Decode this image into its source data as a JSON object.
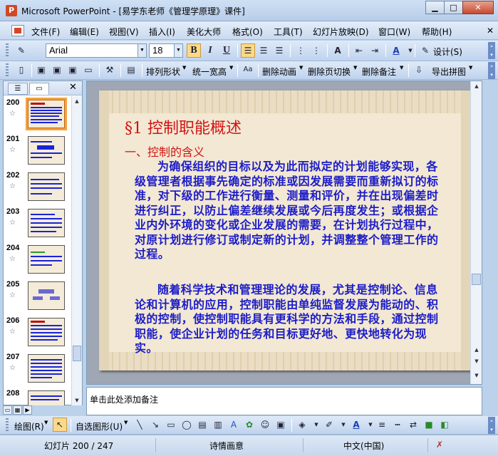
{
  "window": {
    "title": "Microsoft PowerPoint - [易学东老师《管理学原理》课件]",
    "buttons": {
      "minimize": "▁",
      "maximize": "□",
      "close": "✕"
    }
  },
  "menu": {
    "items": [
      "文件(F)",
      "编辑(E)",
      "视图(V)",
      "插入(I)",
      "美化大师",
      "格式(O)",
      "工具(T)",
      "幻灯片放映(D)",
      "窗口(W)",
      "帮助(H)"
    ]
  },
  "format_toolbar": {
    "font": "Arial",
    "size": "18",
    "bold": "B",
    "italic": "I",
    "underline": "U",
    "design_label": "设计(S)"
  },
  "toolbar2": {
    "arrange": "排列形状",
    "same_width": "统一宽高",
    "remove_anim": "删除动画",
    "remove_transition": "删除页切换",
    "remove_notes": "删除备注",
    "export": "导出拼图"
  },
  "slides_panel": {
    "close": "✕",
    "selected": "200",
    "slides": [
      {
        "num": "200",
        "type": "text"
      },
      {
        "num": "201",
        "type": "diagram"
      },
      {
        "num": "202",
        "type": "text"
      },
      {
        "num": "203",
        "type": "text"
      },
      {
        "num": "204",
        "type": "text"
      },
      {
        "num": "205",
        "type": "diagram"
      },
      {
        "num": "206",
        "type": "text"
      },
      {
        "num": "207",
        "type": "text"
      },
      {
        "num": "208",
        "type": "text"
      }
    ]
  },
  "slide": {
    "title": "§1  控制职能概述",
    "subtitle": "一、控制的含义",
    "para1": "为确保组织的目标以及为此而拟定的计划能够实现，各级管理者根据事先确定的标准或因发展需要而重新拟订的标准，对下级的工作进行衡量、测量和评价，并在出现偏差时进行纠正，以防止偏差继续发展或今后再度发生；或根据企业内外环境的变化或企业发展的需要，在计划执行过程中，对原计划进行修订或制定新的计划，并调整整个管理工作的过程。",
    "para2": "随着科学技术和管理理论的发展，尤其是控制论、信息论和计算机的应用，控制职能由单纯监督发展为能动的、积极的控制，使控制职能具有更科学的方法和手段，通过控制职能，使企业计划的任务和目标更好地、更快地转化为现实。"
  },
  "notes": {
    "placeholder": "单击此处添加备注"
  },
  "draw_toolbar": {
    "draw": "绘图(R)",
    "autoshape": "自选图形(U)"
  },
  "status": {
    "slide_pos": "幻灯片 200 / 247",
    "theme": "诗情画意",
    "language": "中文(中国)"
  },
  "colors": {
    "title_red": "#d21414",
    "body_blue": "#1c1cc8",
    "slide_bg": "#f2e8d3"
  }
}
